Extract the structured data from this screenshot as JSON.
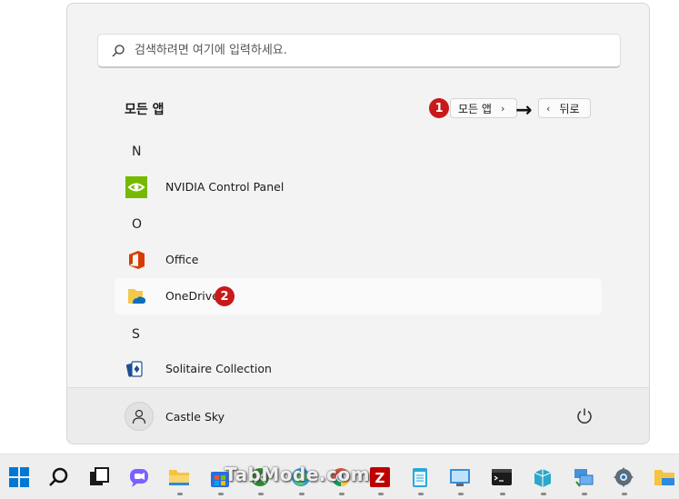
{
  "search": {
    "placeholder": "검색하려면 여기에 입력하세요."
  },
  "all_apps": {
    "title": "모든 앱",
    "all_apps_button": "모든 앱",
    "back_button": "뒤로",
    "badge1": "1",
    "badge2": "2"
  },
  "apps": {
    "letter_n": "N",
    "nvidia": "NVIDIA Control Panel",
    "letter_o": "O",
    "office": "Office",
    "onedrive": "OneDrive",
    "letter_s": "S",
    "solitaire": "Solitaire Collection"
  },
  "footer": {
    "user_name": "Castle Sky"
  },
  "watermark": "TabMode.com",
  "colors": {
    "badge": "#c81a1a",
    "accent": "#0078d4"
  }
}
